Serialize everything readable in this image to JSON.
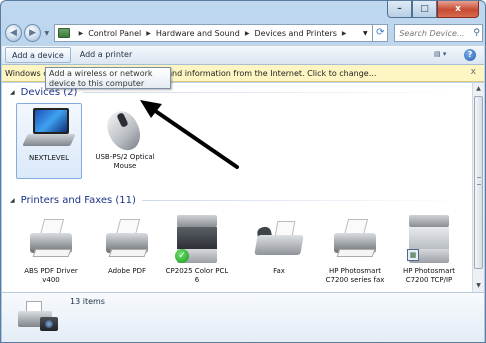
{
  "window": {
    "caption_buttons": {
      "minimize": "–",
      "maximize": "□",
      "close": "x"
    }
  },
  "address_bar": {
    "breadcrumbs": [
      "Control Panel",
      "Hardware and Sound",
      "Devices and Printers"
    ],
    "search_placeholder": "Search Device..."
  },
  "command_bar": {
    "add_device": "Add a device",
    "add_printer": "Add a printer"
  },
  "info_bar": {
    "text": "Windows can download device software and information from the Internet. Click to change...",
    "close": "x"
  },
  "tooltip": {
    "text": "Add a wireless or network device to this computer"
  },
  "groups": {
    "devices": {
      "header": "Devices (2)",
      "items": [
        {
          "label": "NEXTLEVEL",
          "icon": "laptop-icon",
          "selected": true
        },
        {
          "label": "USB-PS/2 Optical Mouse",
          "icon": "mouse-icon",
          "selected": false
        }
      ]
    },
    "printers": {
      "header": "Printers and Faxes (11)",
      "items": [
        {
          "label": "ABS PDF Driver v400",
          "icon": "printer-icon"
        },
        {
          "label": "Adobe PDF",
          "icon": "printer-icon"
        },
        {
          "label": "CP2025 Color PCL 6",
          "icon": "multifunction-printer-icon",
          "default": true
        },
        {
          "label": "Fax",
          "icon": "fax-icon"
        },
        {
          "label": "HP Photosmart C7200 series fax",
          "icon": "printer-icon"
        },
        {
          "label": "HP Photosmart C7200 TCP/IP",
          "icon": "multifunction-printer-icon"
        }
      ]
    }
  },
  "details_pane": {
    "count": "13 items"
  },
  "colors": {
    "group_header": "#1e3287",
    "info_bar_bg": "#fdf6c2",
    "selected_tile": "#dbe9fa"
  }
}
